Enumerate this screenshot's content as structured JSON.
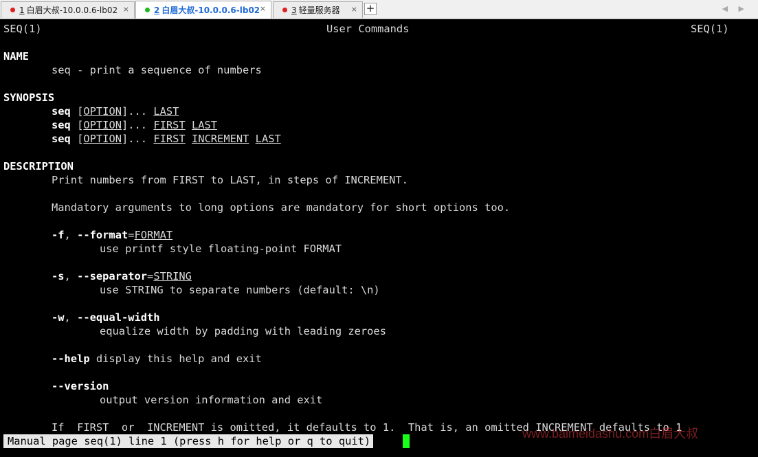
{
  "tabs": [
    {
      "num": "1",
      "label": "白眉大叔-10.0.0.6-lb02",
      "dot_color": "#e02020",
      "close": "×"
    },
    {
      "num": "2",
      "label": "白眉大叔-10.0.0.6-lb02",
      "dot_color": "#1fb81f",
      "close": "×"
    },
    {
      "num": "3",
      "label": "轻量服务器",
      "dot_color": "#e02020",
      "close": "×"
    }
  ],
  "add_tab": "+",
  "nav_arrows": "◀ ▶",
  "man": {
    "header_left": "SEQ(1)",
    "header_center": "User Commands",
    "header_right": "SEQ(1)",
    "name_heading": "NAME",
    "name_desc": "seq - print a sequence of numbers",
    "synopsis_heading": "SYNOPSIS",
    "cmd": "seq",
    "open_bracket": "[",
    "option": "OPTION",
    "close_bracket": "]",
    "ellipsis": "...",
    "last": "LAST",
    "first": "FIRST",
    "increment": "INCREMENT",
    "description_heading": "DESCRIPTION",
    "desc_line1": "Print numbers from FIRST to LAST, in steps of INCREMENT.",
    "desc_line2": "Mandatory arguments to long options are mandatory for short options too.",
    "opt_f_short": "-f",
    "opt_f_long": "--format",
    "opt_f_arg": "FORMAT",
    "opt_f_desc": "use printf style floating-point FORMAT",
    "opt_s_short": "-s",
    "opt_s_long": "--separator",
    "opt_s_arg": "STRING",
    "opt_s_desc": "use STRING to separate numbers (default: \\n)",
    "opt_w_short": "-w",
    "opt_w_long": "--equal-width",
    "opt_w_desc": "equalize width by padding with leading zeroes",
    "opt_help": "--help",
    "opt_help_desc": "display this help and exit",
    "opt_version": "--version",
    "opt_version_desc": "output version information and exit",
    "last_line": "If  FIRST  or  INCREMENT is omitted, it defaults to 1.  That is, an omitted INCREMENT defaults to 1"
  },
  "status": "Manual page seq(1) line 1 (press h for help or q to quit)",
  "watermark": "www.baimeidashu.com白眉大叔",
  "colors": {
    "cursor": "#1aff1a",
    "terminal_bg": "#000000",
    "active_tab_text": "#1e6bd8"
  }
}
